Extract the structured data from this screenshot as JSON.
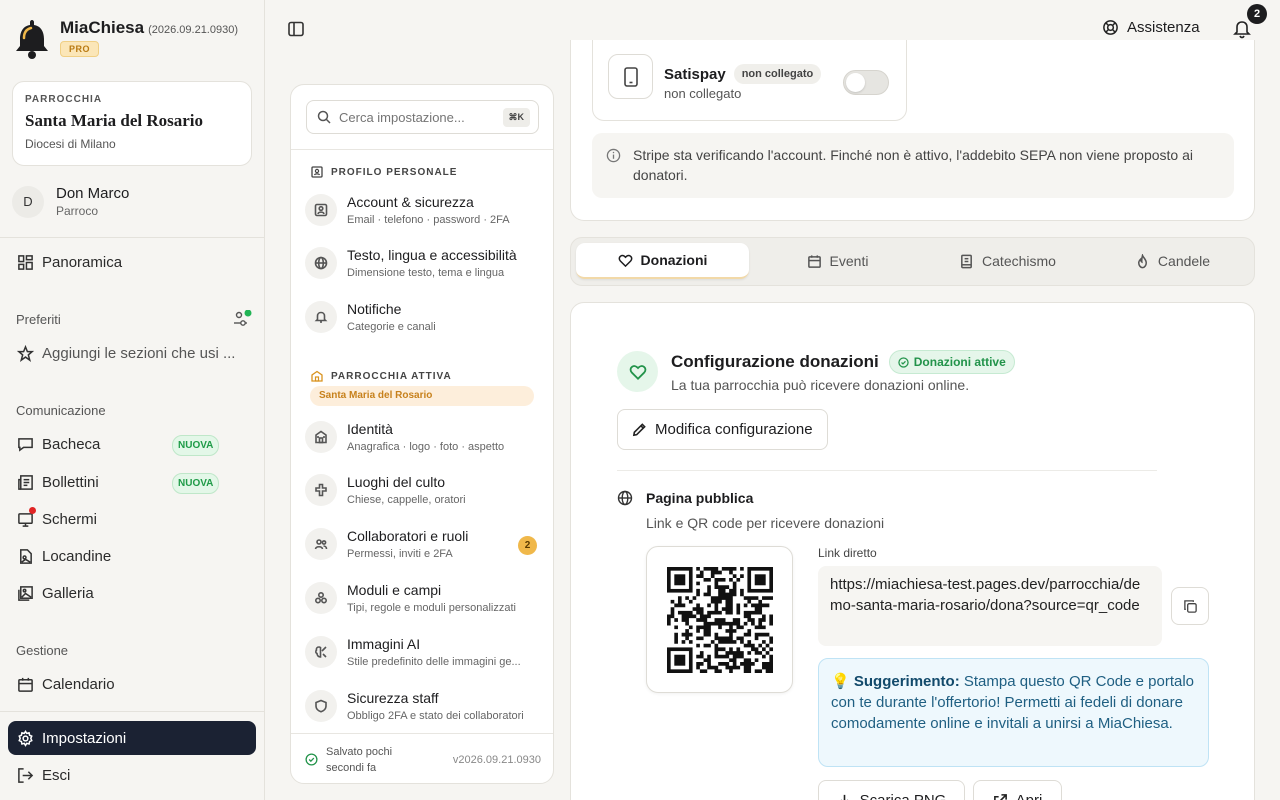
{
  "brand": {
    "name": "MiaChiesa",
    "version": "(2026.09.21.0930)",
    "plan": "PRO"
  },
  "parish": {
    "label": "PARROCCHIA",
    "name": "Santa Maria del Rosario",
    "diocese": "Diocesi di Milano"
  },
  "user": {
    "initial": "D",
    "name": "Don Marco",
    "role": "Parroco"
  },
  "nav": {
    "overview": "Panoramica",
    "favorites_title": "Preferiti",
    "favorites_add": "Aggiungi le sezioni che usi ...",
    "communication_title": "Comunicazione",
    "communication": [
      {
        "label": "Bacheca",
        "badge": "NUOVA"
      },
      {
        "label": "Bollettini",
        "badge": "NUOVA"
      },
      {
        "label": "Schermi"
      },
      {
        "label": "Locandine"
      },
      {
        "label": "Galleria"
      }
    ],
    "management_title": "Gestione",
    "calendar": "Calendario",
    "settings": "Impostazioni",
    "logout": "Esci"
  },
  "topbar": {
    "help": "Assistenza",
    "notifications_count": "2"
  },
  "settings_panel": {
    "search_placeholder": "Cerca impostazione...",
    "shortcut": "⌘K",
    "personal_title": "PROFILO PERSONALE",
    "personal": [
      {
        "title": "Account & sicurezza",
        "subtitle": "Email · telefono · password · 2FA"
      },
      {
        "title": "Testo, lingua e accessibilità",
        "subtitle": "Dimensione testo, tema e lingua"
      },
      {
        "title": "Notifiche",
        "subtitle": "Categorie e canali"
      }
    ],
    "parish_title": "PARROCCHIA ATTIVA",
    "parish_name": "Santa Maria del Rosario",
    "parish_items": [
      {
        "title": "Identità",
        "subtitle": "Anagrafica · logo · foto · aspetto"
      },
      {
        "title": "Luoghi del culto",
        "subtitle": "Chiese, cappelle, oratori"
      },
      {
        "title": "Collaboratori e ruoli",
        "subtitle": "Permessi, inviti e 2FA",
        "count": "2"
      },
      {
        "title": "Moduli e campi",
        "subtitle": "Tipi, regole e moduli personalizzati"
      },
      {
        "title": "Immagini AI",
        "subtitle": "Stile predefinito delle immagini ge..."
      },
      {
        "title": "Sicurezza staff",
        "subtitle": "Obbligo 2FA e stato dei collaboratori"
      }
    ],
    "saved_status": "Salvato pochi secondi fa",
    "version": "v2026.09.21.0930"
  },
  "payment": {
    "name": "Satispay",
    "badge": "non collegato",
    "status": "non collegato",
    "enabled": false,
    "info": "Stripe sta verificando l'account. Finché non è attivo, l'addebito SEPA non viene proposto ai donatori."
  },
  "tabs": [
    {
      "label": "Donazioni",
      "active": true
    },
    {
      "label": "Eventi"
    },
    {
      "label": "Catechismo"
    },
    {
      "label": "Candele"
    }
  ],
  "donations": {
    "title": "Configurazione donazioni",
    "status": "Donazioni attive",
    "subtitle": "La tua parrocchia può ricevere donazioni online.",
    "edit_button": "Modifica configurazione",
    "public_title": "Pagina pubblica",
    "public_subtitle": "Link e QR code per ricevere donazioni",
    "link_label": "Link diretto",
    "link": "https://miachiesa-test.pages.dev/parrocchia/demo-santa-maria-rosario/dona?source=qr_code",
    "tip_icon": "💡",
    "tip_bold": "Suggerimento:",
    "tip_text": "Stampa questo QR Code e portalo con te durante l'offertorio! Permetti ai fedeli di donare comodamente online e invitali a unirsi a MiaChiesa.",
    "download_button": "Scarica PNG",
    "open_button": "Apri"
  }
}
